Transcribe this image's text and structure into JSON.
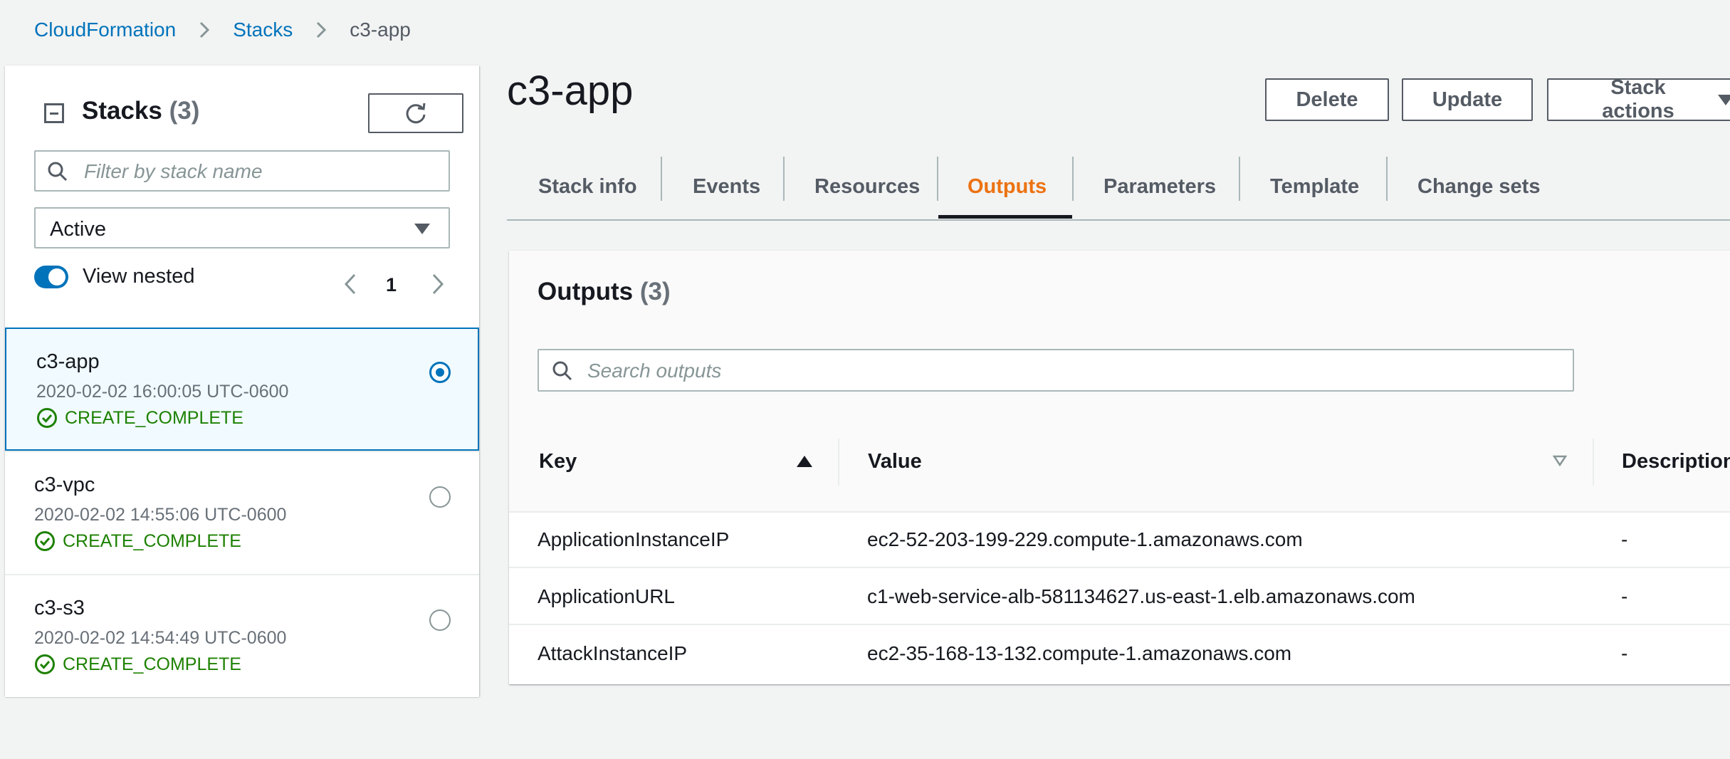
{
  "breadcrumb": {
    "items": [
      "CloudFormation",
      "Stacks"
    ],
    "current": "c3-app"
  },
  "sidebar": {
    "title": "Stacks",
    "count": "(3)",
    "filter_placeholder": "Filter by stack name",
    "status_filter": "Active",
    "view_nested_label": "View nested",
    "view_nested_on": true,
    "page": "1",
    "stacks": [
      {
        "name": "c3-app",
        "date": "2020-02-02 16:00:05 UTC-0600",
        "status": "CREATE_COMPLETE",
        "selected": true
      },
      {
        "name": "c3-vpc",
        "date": "2020-02-02 14:55:06 UTC-0600",
        "status": "CREATE_COMPLETE",
        "selected": false
      },
      {
        "name": "c3-s3",
        "date": "2020-02-02 14:54:49 UTC-0600",
        "status": "CREATE_COMPLETE",
        "selected": false
      }
    ]
  },
  "main": {
    "title": "c3-app",
    "buttons": {
      "delete": "Delete",
      "update": "Update",
      "actions": "Stack actions"
    },
    "tabs": [
      "Stack info",
      "Events",
      "Resources",
      "Outputs",
      "Parameters",
      "Template",
      "Change sets"
    ],
    "active_tab": "Outputs"
  },
  "outputs": {
    "title": "Outputs",
    "count": "(3)",
    "search_placeholder": "Search outputs",
    "columns": {
      "key": "Key",
      "value": "Value",
      "description": "Description"
    },
    "rows": [
      {
        "key": "ApplicationInstanceIP",
        "value": "ec2-52-203-199-229.compute-1.amazonaws.com",
        "description": "-"
      },
      {
        "key": "ApplicationURL",
        "value": "c1-web-service-alb-581134627.us-east-1.elb.amazonaws.com",
        "description": "-"
      },
      {
        "key": "AttackInstanceIP",
        "value": "ec2-35-168-13-132.compute-1.amazonaws.com",
        "description": "-"
      }
    ]
  },
  "colors": {
    "link": "#0073bb",
    "active_tab": "#ec7211",
    "success": "#1d8102",
    "selected_bg": "#f1faff"
  }
}
